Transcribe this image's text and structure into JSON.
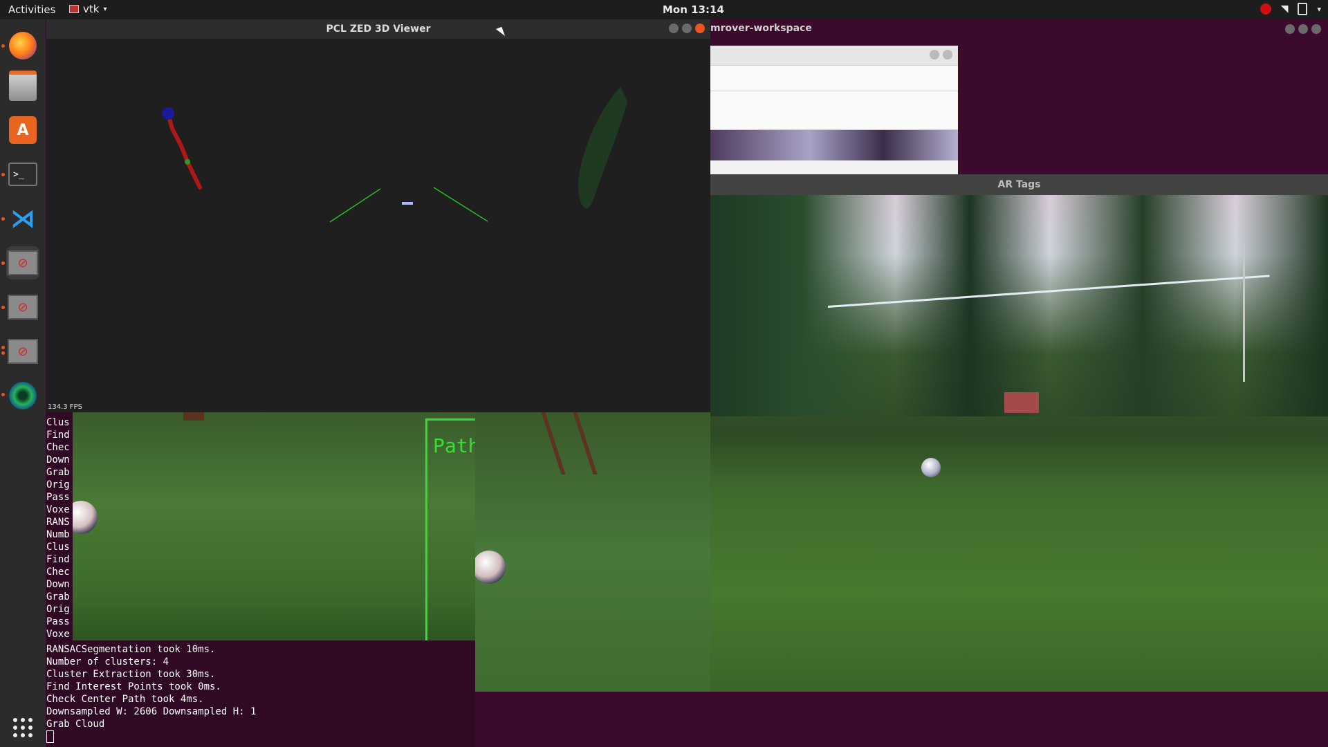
{
  "topbar": {
    "activities": "Activities",
    "app_name": "vtk",
    "clock": "Mon 13:14"
  },
  "dock": {
    "items": [
      "firefox-icon",
      "files-icon",
      "software-icon",
      "terminal-icon",
      "vscode-icon",
      "app-icon",
      "app-icon",
      "app-icon",
      "camera-icon"
    ],
    "show_apps": "apps-grid-icon"
  },
  "pcl_window": {
    "title": "PCL ZED 3D Viewer",
    "fps": "134.3 FPS"
  },
  "bg_window": {
    "title": "mrover-workspace"
  },
  "ar_window": {
    "title": "AR Tags"
  },
  "camera_left": {
    "overlay_label": "Path C"
  },
  "terminal": {
    "pane_lines": [
      "Clus",
      "Find",
      "Chec",
      "Down",
      "Grab",
      "Orig",
      "Pass",
      "Voxe",
      "RANS",
      "Numb",
      "Clus",
      "Find",
      "Chec",
      "Down",
      "Grab",
      "Orig",
      "Pass",
      "Voxe"
    ],
    "log_lines": [
      "RANSACSegmentation took 10ms.",
      "Number of clusters: 4",
      "Cluster Extraction took 30ms.",
      "Find Interest Points took 0ms.",
      "Check Center Path took 4ms.",
      "Downsampled W: 2606 Downsampled H: 1",
      "Grab Cloud"
    ]
  },
  "colors": {
    "accent": "#e95420",
    "path_box": "#32e032",
    "terminal_bg": "#300a24"
  }
}
